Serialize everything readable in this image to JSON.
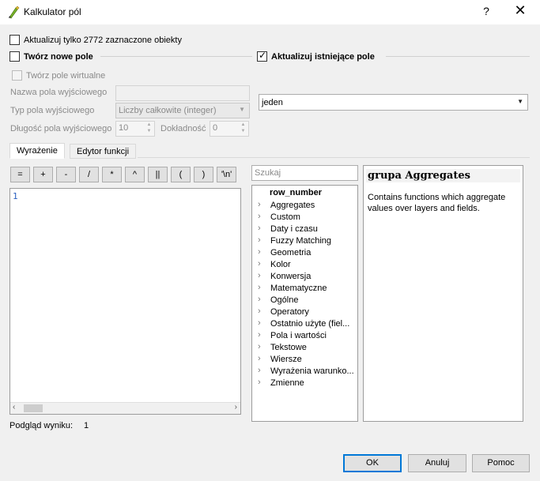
{
  "window": {
    "title": "Kalkulator pól",
    "help": "?",
    "close": "✕"
  },
  "options": {
    "update_selected": "Aktualizuj tylko 2772 zaznaczone obiekty",
    "create_new_field": "Twórz nowe pole",
    "update_existing": "Aktualizuj istniejące pole",
    "virtual_field": "Twórz pole wirtualne",
    "output_name_label": "Nazwa pola wyjściowego",
    "output_type_label": "Typ pola wyjściowego",
    "output_type_value": "Liczby całkowite (integer)",
    "output_length_label": "Długość pola wyjściowego",
    "output_length_value": "10",
    "precision_label": "Dokładność",
    "precision_value": "0",
    "existing_field_value": "jeden"
  },
  "tabs": [
    "Wyrażenie",
    "Edytor funkcji"
  ],
  "operators": [
    "=",
    "+",
    "-",
    "/",
    "*",
    "^",
    "||",
    "(",
    ")",
    "'\\n'"
  ],
  "expression": {
    "text": "1"
  },
  "search": {
    "placeholder": "Szukaj"
  },
  "tree": {
    "selected": "row_number",
    "items": [
      "Aggregates",
      "Custom",
      "Daty i czasu",
      "Fuzzy Matching",
      "Geometria",
      "Kolor",
      "Konwersja",
      "Matematyczne",
      "Ogólne",
      "Operatory",
      "Ostatnio użyte (fiel...",
      "Pola i wartości",
      "Tekstowe",
      "Wiersze",
      "Wyrażenia warunko...",
      "Zmienne"
    ]
  },
  "help_panel": {
    "title": "grupa Aggregates",
    "body": "Contains functions which aggregate values over layers and fields."
  },
  "preview": {
    "label": "Podgląd wyniku:",
    "value": "1"
  },
  "buttons": {
    "ok": "OK",
    "cancel": "Anuluj",
    "help": "Pomoc"
  },
  "colors": {
    "accent": "#0078d7",
    "help_title": "#4a7ebb"
  }
}
